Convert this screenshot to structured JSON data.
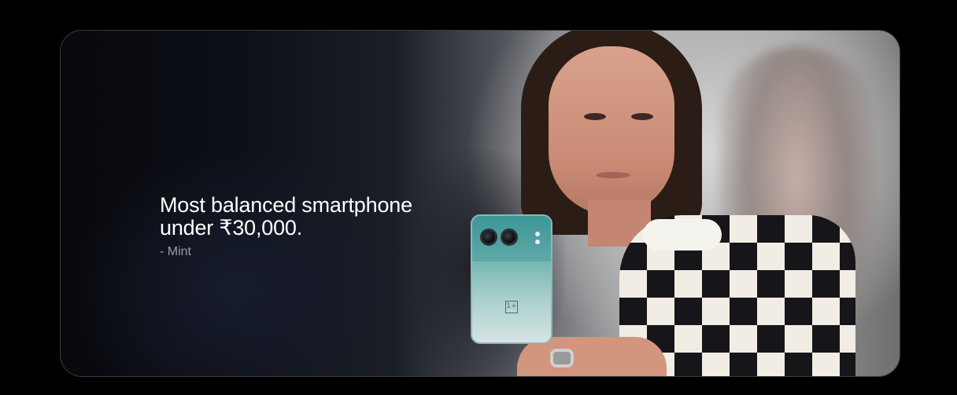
{
  "banner": {
    "headline_line1": "Most balanced smartphone",
    "headline_line2": "under ₹30,000.",
    "source": "- Mint",
    "phone_logo": "1+"
  },
  "colors": {
    "page_background": "#000000",
    "headline_text": "#ffffff",
    "source_text": "#9a9ca2",
    "phone_body": "#74b6b2"
  },
  "icons": {
    "phone_brand_mark": "oneplus-logo-icon"
  }
}
